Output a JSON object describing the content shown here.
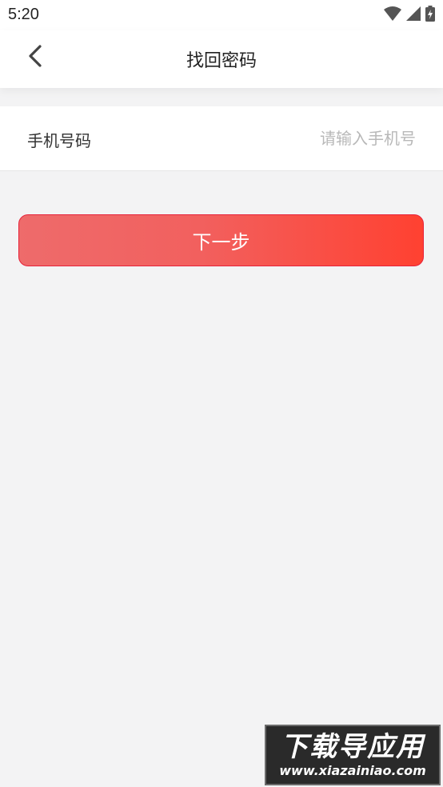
{
  "status_bar": {
    "time": "5:20",
    "icons": [
      "wifi-icon",
      "signal-icon",
      "battery-charging-icon"
    ]
  },
  "header": {
    "title": "找回密码",
    "back_icon": "chevron-left-icon"
  },
  "form": {
    "phone": {
      "label": "手机号码",
      "value": "",
      "placeholder": "请输入手机号"
    }
  },
  "actions": {
    "next_label": "下一步"
  },
  "watermark": {
    "main": "下载导应用",
    "sub": "www.xiazainiao.com"
  },
  "colors": {
    "accent_start": "#ee6b6b",
    "accent_end": "#ff4131",
    "accent_border": "#e6223a",
    "background": "#f3f3f4"
  }
}
